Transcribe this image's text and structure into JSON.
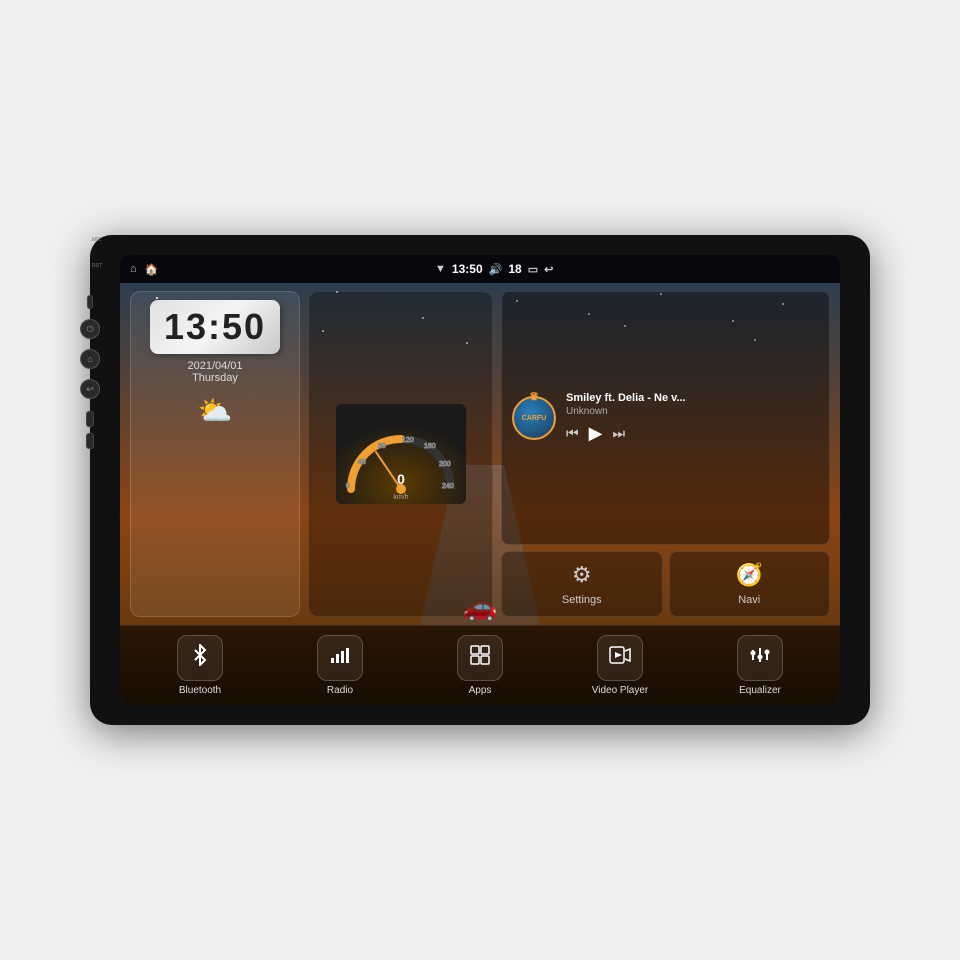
{
  "device": {
    "title": "Car Head Unit"
  },
  "statusBar": {
    "leftIcons": [
      "⌂",
      "⌂"
    ],
    "time": "13:50",
    "signal": "▼",
    "volume": "🔊",
    "volumeLevel": "18",
    "battery": "▭",
    "back": "↩"
  },
  "clock": {
    "time": "13:50",
    "date": "2021/04/01",
    "day": "Thursday"
  },
  "music": {
    "title": "Smiley ft. Delia - Ne v...",
    "artist": "Unknown",
    "logoText": "CARFU"
  },
  "settings": {
    "label": "Settings"
  },
  "navi": {
    "label": "Navi"
  },
  "apps": [
    {
      "id": "bluetooth",
      "label": "Bluetooth",
      "icon": "⛾"
    },
    {
      "id": "radio",
      "label": "Radio",
      "icon": "📻"
    },
    {
      "id": "apps",
      "label": "Apps",
      "icon": "⊞"
    },
    {
      "id": "video",
      "label": "Video Player",
      "icon": "▶"
    },
    {
      "id": "eq",
      "label": "Equalizer",
      "icon": "⋮"
    }
  ],
  "sideButtons": [
    {
      "id": "mic",
      "label": "MIC"
    },
    {
      "id": "rst",
      "label": "RST"
    },
    {
      "id": "power",
      "label": ""
    },
    {
      "id": "home",
      "label": ""
    },
    {
      "id": "back",
      "label": ""
    },
    {
      "id": "volup",
      "label": "+"
    },
    {
      "id": "voldn",
      "label": "-"
    }
  ]
}
